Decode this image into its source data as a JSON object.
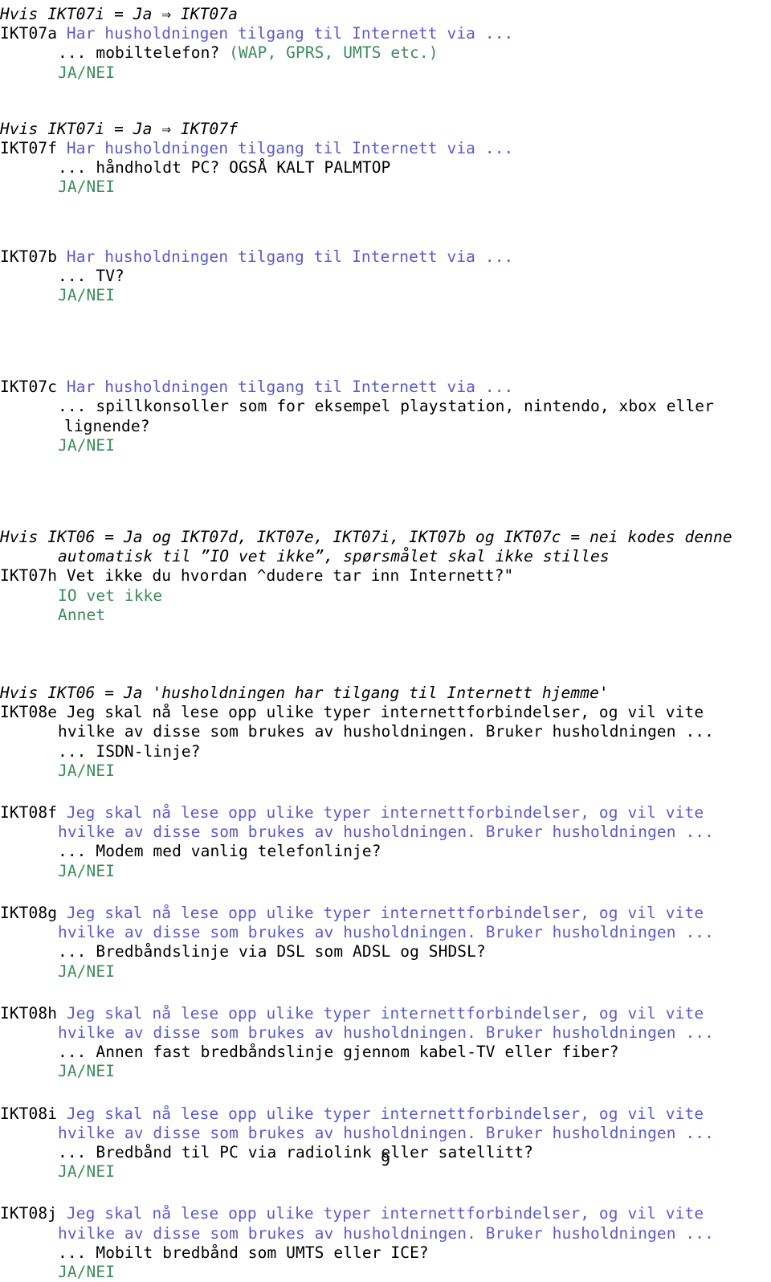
{
  "document": {
    "page_number": "9",
    "colors": {
      "question_text": "#5b5bc9",
      "answer_options": "#3d8b5c",
      "body_text": "#000000",
      "background": "#ffffff"
    }
  },
  "blocks": [
    {
      "id": "ikt07a",
      "condition": "Hvis IKT07i = Ja ⇒ IKT07a",
      "code": "IKT07a",
      "question": "Har husholdningen tilgang til Internett via ...",
      "item": "... mobiltelefon? ",
      "item_note": "(WAP, GPRS, UMTS etc.)",
      "answer": "JA/NEI"
    },
    {
      "id": "ikt07f",
      "condition": "Hvis IKT07i = Ja ⇒ IKT07f",
      "code": "IKT07f",
      "question": "Har husholdningen tilgang til Internett via ...",
      "item": "... håndholdt PC? OGSÅ KALT PALMTOP",
      "answer": "JA/NEI"
    },
    {
      "id": "ikt07b",
      "code": "IKT07b",
      "question": "Har husholdningen tilgang til Internett via ...",
      "item": "... TV?",
      "answer": "JA/NEI"
    },
    {
      "id": "ikt07c",
      "code": "IKT07c",
      "question": "Har husholdningen tilgang til Internett via ...",
      "item": "... spillkonsoller som for eksempel playstation, nintendo, xbox eller",
      "item_cont": "lignende?",
      "answer": "JA/NEI"
    },
    {
      "id": "ikt07h",
      "condition": "Hvis IKT06 = Ja og IKT07d, IKT07e, IKT07i, IKT07b og IKT07c = nei kodes denne",
      "condition_cont": "automatisk til ”IO vet ikke”, spørsmålet skal ikke stilles",
      "code": "IKT07h",
      "question": "Vet ikke du hvordan ^dudere tar inn Internett?\"",
      "answer_1": "IO vet ikke",
      "answer_2": "Annet"
    },
    {
      "id": "ikt08e",
      "condition": "Hvis IKT06 = Ja 'husholdningen har tilgang til Internett hjemme'",
      "code": "IKT08e",
      "question": "Jeg skal nå lese opp ulike typer internettforbindelser, og vil vite",
      "question_cont": "hvilke av disse som brukes av husholdningen. Bruker husholdningen ...",
      "item": "... ISDN-linje?",
      "answer": "JA/NEI"
    },
    {
      "id": "ikt08f",
      "code": "IKT08f",
      "question": "Jeg skal nå lese opp ulike typer internettforbindelser, og vil vite",
      "question_cont": "hvilke av disse som brukes av husholdningen. Bruker husholdningen ...",
      "item": "... Modem med vanlig telefonlinje?",
      "answer": "JA/NEI"
    },
    {
      "id": "ikt08g",
      "code": "IKT08g",
      "question": "Jeg skal nå lese opp ulike typer internettforbindelser, og vil vite",
      "question_cont": "hvilke av disse som brukes av husholdningen. Bruker husholdningen ...",
      "item": "... Bredbåndslinje via DSL som ADSL og SHDSL?",
      "answer": "JA/NEI"
    },
    {
      "id": "ikt08h",
      "code": "IKT08h",
      "question": "Jeg skal nå lese opp ulike typer internettforbindelser, og vil vite",
      "question_cont": "hvilke av disse som brukes av husholdningen. Bruker husholdningen ...",
      "item": "... Annen fast bredbåndslinje gjennom kabel-TV eller fiber?",
      "answer": "JA/NEI"
    },
    {
      "id": "ikt08i",
      "code": "IKT08i",
      "question": "Jeg skal nå lese opp ulike typer internettforbindelser, og vil vite",
      "question_cont": "hvilke av disse som brukes av husholdningen. Bruker husholdningen ...",
      "item": "... Bredbånd til PC via radiolink eller satellitt?",
      "answer": "JA/NEI"
    },
    {
      "id": "ikt08j",
      "code": "IKT08j",
      "question": "Jeg skal nå lese opp ulike typer internettforbindelser, og vil vite",
      "question_cont": "hvilke av disse som brukes av husholdningen. Bruker husholdningen ...",
      "item": "... Mobilt bredbånd som UMTS eller ICE?",
      "answer": "JA/NEI"
    }
  ]
}
